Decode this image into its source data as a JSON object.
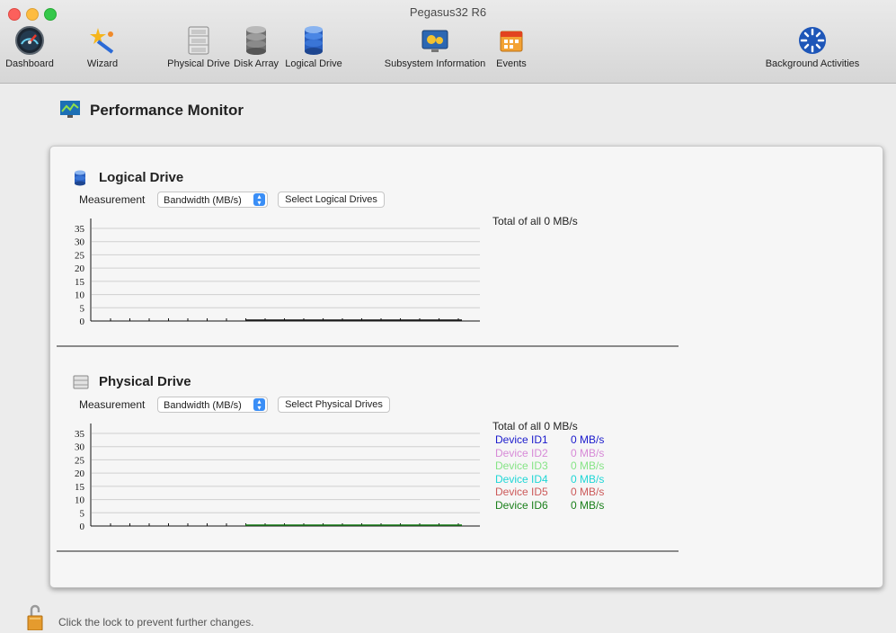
{
  "window": {
    "title": "Pegasus32 R6"
  },
  "toolbar": {
    "items": [
      {
        "label": "Dashboard",
        "icon": "dashboard-gauge-icon"
      },
      {
        "label": "Wizard",
        "icon": "wizard-wand-icon"
      },
      {
        "label": "Physical Drive",
        "icon": "physical-drive-icon"
      },
      {
        "label": "Disk Array",
        "icon": "disk-array-icon"
      },
      {
        "label": "Logical Drive",
        "icon": "logical-drive-icon"
      },
      {
        "label": "Subsystem Information",
        "icon": "subsystem-info-icon"
      },
      {
        "label": "Events",
        "icon": "events-calendar-icon"
      },
      {
        "label": "Background Activities",
        "icon": "background-activities-icon"
      }
    ]
  },
  "page": {
    "title": "Performance Monitor"
  },
  "logical": {
    "title": "Logical Drive",
    "measurement_label": "Measurement",
    "measurement_value": "Bandwidth (MB/s)",
    "select_button": "Select Logical Drives",
    "total": "Total of all 0 MB/s",
    "y_ticks": [
      "35",
      "30",
      "25",
      "20",
      "15",
      "10",
      "5",
      "0"
    ]
  },
  "physical": {
    "title": "Physical Drive",
    "measurement_label": "Measurement",
    "measurement_value": "Bandwidth (MB/s)",
    "select_button": "Select Physical Drives",
    "total": "Total of all 0 MB/s",
    "y_ticks": [
      "35",
      "30",
      "25",
      "20",
      "15",
      "10",
      "5",
      "0"
    ],
    "devices": [
      {
        "name": "Device ID1",
        "value": "0 MB/s",
        "color": "#1a1acc"
      },
      {
        "name": "Device ID2",
        "value": "0 MB/s",
        "color": "#d78ad7"
      },
      {
        "name": "Device ID3",
        "value": "0 MB/s",
        "color": "#86e486"
      },
      {
        "name": "Device ID4",
        "value": "0 MB/s",
        "color": "#1fd6d6"
      },
      {
        "name": "Device ID5",
        "value": "0 MB/s",
        "color": "#cc5a5a"
      },
      {
        "name": "Device ID6",
        "value": "0 MB/s",
        "color": "#1a7f1a"
      }
    ]
  },
  "chart_data": [
    {
      "type": "line",
      "title": "",
      "ylim": [
        0,
        35
      ],
      "y_ticks": [
        0,
        5,
        10,
        15,
        20,
        25,
        30,
        35
      ],
      "series": [
        {
          "values": [
            0,
            0,
            0,
            0,
            0,
            0,
            0,
            0,
            0,
            0,
            0,
            0,
            0,
            0,
            0,
            0,
            0,
            0,
            0,
            0
          ]
        }
      ],
      "grid": true
    },
    {
      "type": "line",
      "title": "",
      "ylim": [
        0,
        35
      ],
      "y_ticks": [
        0,
        5,
        10,
        15,
        20,
        25,
        30,
        35
      ],
      "series": [
        {
          "values": [
            0,
            0,
            0,
            0,
            0,
            0,
            0,
            0,
            0,
            0,
            0,
            0,
            0,
            0,
            0,
            0,
            0,
            0,
            0,
            0
          ]
        }
      ],
      "grid": true
    }
  ],
  "footer": {
    "lock_text": "Click the lock to prevent further changes."
  }
}
